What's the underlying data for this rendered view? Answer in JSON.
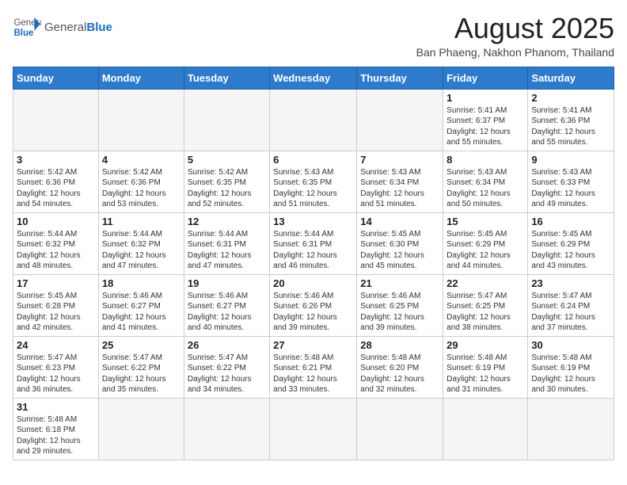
{
  "header": {
    "logo_general": "General",
    "logo_blue": "Blue",
    "month_title": "August 2025",
    "location": "Ban Phaeng, Nakhon Phanom, Thailand"
  },
  "weekdays": [
    "Sunday",
    "Monday",
    "Tuesday",
    "Wednesday",
    "Thursday",
    "Friday",
    "Saturday"
  ],
  "weeks": [
    [
      {
        "day": "",
        "info": ""
      },
      {
        "day": "",
        "info": ""
      },
      {
        "day": "",
        "info": ""
      },
      {
        "day": "",
        "info": ""
      },
      {
        "day": "",
        "info": ""
      },
      {
        "day": "1",
        "info": "Sunrise: 5:41 AM\nSunset: 6:37 PM\nDaylight: 12 hours\nand 55 minutes."
      },
      {
        "day": "2",
        "info": "Sunrise: 5:41 AM\nSunset: 6:36 PM\nDaylight: 12 hours\nand 55 minutes."
      }
    ],
    [
      {
        "day": "3",
        "info": "Sunrise: 5:42 AM\nSunset: 6:36 PM\nDaylight: 12 hours\nand 54 minutes."
      },
      {
        "day": "4",
        "info": "Sunrise: 5:42 AM\nSunset: 6:36 PM\nDaylight: 12 hours\nand 53 minutes."
      },
      {
        "day": "5",
        "info": "Sunrise: 5:42 AM\nSunset: 6:35 PM\nDaylight: 12 hours\nand 52 minutes."
      },
      {
        "day": "6",
        "info": "Sunrise: 5:43 AM\nSunset: 6:35 PM\nDaylight: 12 hours\nand 51 minutes."
      },
      {
        "day": "7",
        "info": "Sunrise: 5:43 AM\nSunset: 6:34 PM\nDaylight: 12 hours\nand 51 minutes."
      },
      {
        "day": "8",
        "info": "Sunrise: 5:43 AM\nSunset: 6:34 PM\nDaylight: 12 hours\nand 50 minutes."
      },
      {
        "day": "9",
        "info": "Sunrise: 5:43 AM\nSunset: 6:33 PM\nDaylight: 12 hours\nand 49 minutes."
      }
    ],
    [
      {
        "day": "10",
        "info": "Sunrise: 5:44 AM\nSunset: 6:32 PM\nDaylight: 12 hours\nand 48 minutes."
      },
      {
        "day": "11",
        "info": "Sunrise: 5:44 AM\nSunset: 6:32 PM\nDaylight: 12 hours\nand 47 minutes."
      },
      {
        "day": "12",
        "info": "Sunrise: 5:44 AM\nSunset: 6:31 PM\nDaylight: 12 hours\nand 47 minutes."
      },
      {
        "day": "13",
        "info": "Sunrise: 5:44 AM\nSunset: 6:31 PM\nDaylight: 12 hours\nand 46 minutes."
      },
      {
        "day": "14",
        "info": "Sunrise: 5:45 AM\nSunset: 6:30 PM\nDaylight: 12 hours\nand 45 minutes."
      },
      {
        "day": "15",
        "info": "Sunrise: 5:45 AM\nSunset: 6:29 PM\nDaylight: 12 hours\nand 44 minutes."
      },
      {
        "day": "16",
        "info": "Sunrise: 5:45 AM\nSunset: 6:29 PM\nDaylight: 12 hours\nand 43 minutes."
      }
    ],
    [
      {
        "day": "17",
        "info": "Sunrise: 5:45 AM\nSunset: 6:28 PM\nDaylight: 12 hours\nand 42 minutes."
      },
      {
        "day": "18",
        "info": "Sunrise: 5:46 AM\nSunset: 6:27 PM\nDaylight: 12 hours\nand 41 minutes."
      },
      {
        "day": "19",
        "info": "Sunrise: 5:46 AM\nSunset: 6:27 PM\nDaylight: 12 hours\nand 40 minutes."
      },
      {
        "day": "20",
        "info": "Sunrise: 5:46 AM\nSunset: 6:26 PM\nDaylight: 12 hours\nand 39 minutes."
      },
      {
        "day": "21",
        "info": "Sunrise: 5:46 AM\nSunset: 6:25 PM\nDaylight: 12 hours\nand 39 minutes."
      },
      {
        "day": "22",
        "info": "Sunrise: 5:47 AM\nSunset: 6:25 PM\nDaylight: 12 hours\nand 38 minutes."
      },
      {
        "day": "23",
        "info": "Sunrise: 5:47 AM\nSunset: 6:24 PM\nDaylight: 12 hours\nand 37 minutes."
      }
    ],
    [
      {
        "day": "24",
        "info": "Sunrise: 5:47 AM\nSunset: 6:23 PM\nDaylight: 12 hours\nand 36 minutes."
      },
      {
        "day": "25",
        "info": "Sunrise: 5:47 AM\nSunset: 6:22 PM\nDaylight: 12 hours\nand 35 minutes."
      },
      {
        "day": "26",
        "info": "Sunrise: 5:47 AM\nSunset: 6:22 PM\nDaylight: 12 hours\nand 34 minutes."
      },
      {
        "day": "27",
        "info": "Sunrise: 5:48 AM\nSunset: 6:21 PM\nDaylight: 12 hours\nand 33 minutes."
      },
      {
        "day": "28",
        "info": "Sunrise: 5:48 AM\nSunset: 6:20 PM\nDaylight: 12 hours\nand 32 minutes."
      },
      {
        "day": "29",
        "info": "Sunrise: 5:48 AM\nSunset: 6:19 PM\nDaylight: 12 hours\nand 31 minutes."
      },
      {
        "day": "30",
        "info": "Sunrise: 5:48 AM\nSunset: 6:19 PM\nDaylight: 12 hours\nand 30 minutes."
      }
    ],
    [
      {
        "day": "31",
        "info": "Sunrise: 5:48 AM\nSunset: 6:18 PM\nDaylight: 12 hours\nand 29 minutes."
      },
      {
        "day": "",
        "info": ""
      },
      {
        "day": "",
        "info": ""
      },
      {
        "day": "",
        "info": ""
      },
      {
        "day": "",
        "info": ""
      },
      {
        "day": "",
        "info": ""
      },
      {
        "day": "",
        "info": ""
      }
    ]
  ]
}
